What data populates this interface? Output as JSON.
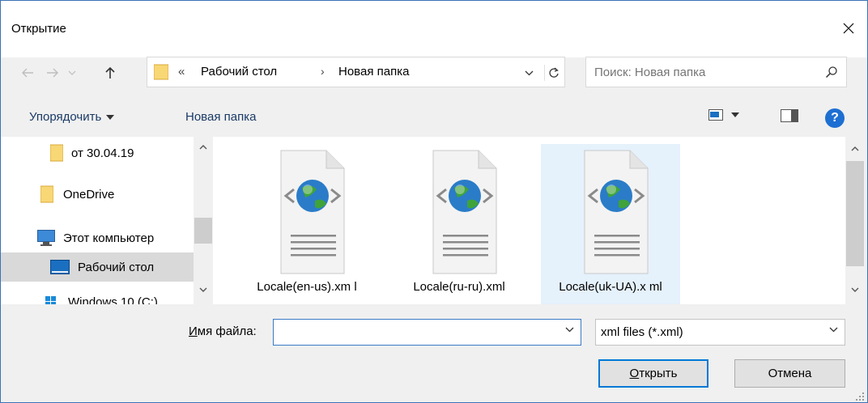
{
  "window": {
    "title": "Открытие"
  },
  "address": {
    "overflow": "«",
    "crumbs": [
      "Рабочий стол",
      "Новая папка"
    ],
    "separator": "›"
  },
  "search": {
    "placeholder": "Поиск: Новая папка"
  },
  "toolbar": {
    "organize_label": "Упорядочить",
    "new_folder_label": "Новая папка",
    "help_label": "?"
  },
  "sidebar": {
    "items": [
      {
        "label": "от 30.04.19",
        "icon": "folder-icon"
      },
      {
        "label": "OneDrive",
        "icon": "folder-icon"
      },
      {
        "label": "Этот компьютер",
        "icon": "computer-icon"
      },
      {
        "label": "Рабочий стол",
        "icon": "desktop-icon",
        "selected": true
      },
      {
        "label": "Windows 10 (C:)",
        "icon": "drive-icon"
      }
    ]
  },
  "files": [
    {
      "name": "Locale(en-us).xm l",
      "icon": "xml-file-icon"
    },
    {
      "name": "Locale(ru-ru).xml",
      "icon": "xml-file-icon"
    },
    {
      "name": "Locale(uk-UA).x ml",
      "icon": "xml-file-icon",
      "selected": true
    }
  ],
  "footer": {
    "filename_label_accel": "И",
    "filename_label_rest": "мя файла:",
    "filename_value": "",
    "filter_value": "xml files (*.xml)",
    "open_accel": "О",
    "open_rest": "ткрыть",
    "cancel_label": "Отмена"
  },
  "colors": {
    "accent": "#0078d7",
    "selection": "#e5f1fb",
    "link_text": "#1a3a66"
  }
}
